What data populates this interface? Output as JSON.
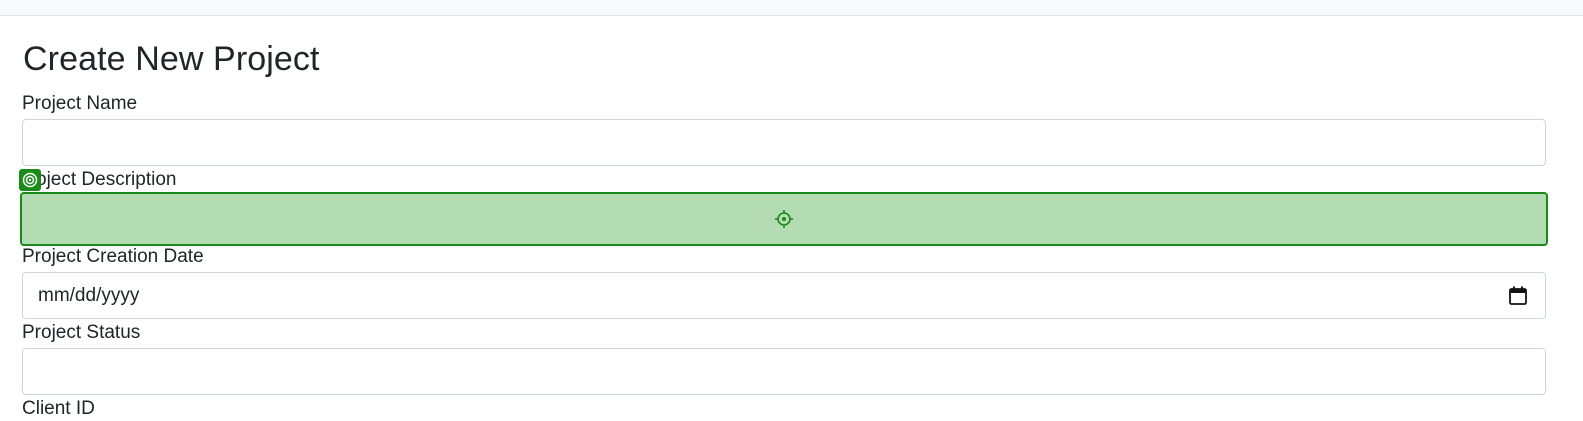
{
  "page": {
    "title": "Create New Project"
  },
  "form": {
    "project_name_label": "Project Name",
    "project_name_value": "",
    "project_description_label": "Project Description",
    "project_description_visible_label": "oject Description",
    "project_creation_date_label": "Project Creation Date",
    "project_creation_date_placeholder": "mm/dd/yyyy",
    "project_status_label": "Project Status",
    "project_status_value": "",
    "client_id_label": "Client ID"
  },
  "icons": {
    "calendar": "calendar-icon",
    "target": "crosshair-icon",
    "marker": "target-marker-icon"
  },
  "colors": {
    "highlight_fill": "#b3dcb3",
    "highlight_border": "#1a8a1a",
    "text": "#212529",
    "input_border": "#ced4da"
  }
}
